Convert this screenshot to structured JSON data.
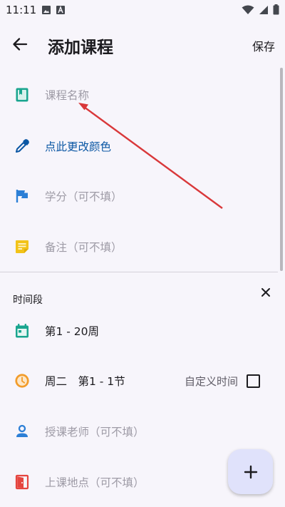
{
  "status_bar": {
    "time": "11:11"
  },
  "app_bar": {
    "title": "添加课程",
    "save_label": "保存"
  },
  "course_name": {
    "placeholder": "课程名称",
    "icon": "book-icon"
  },
  "color": {
    "label": "点此更改颜色",
    "icon": "eyedropper-icon"
  },
  "credit": {
    "placeholder": "学分（可不填）",
    "icon": "flag-icon"
  },
  "note": {
    "placeholder": "备注（可不填）",
    "icon": "note-icon"
  },
  "time_section": {
    "title": "时间段",
    "weeks": "第1 - 20周",
    "day_period": "周二　第1 - 1节",
    "custom_time_label": "自定义时间",
    "custom_time_checked": false,
    "teacher_placeholder": "授课老师（可不填）",
    "location_placeholder": "上课地点（可不填）"
  },
  "colors": {
    "accent": "#0b57a4",
    "book_icon": "#1aa58f",
    "flag_icon": "#2c7fd6",
    "note_icon": "#f2c318",
    "calendar_icon": "#1aa58f",
    "clock_icon": "#f29c2b",
    "person_icon": "#2c7fd6",
    "door_icon": "#e5453f",
    "annotation_arrow": "#d9383a"
  }
}
